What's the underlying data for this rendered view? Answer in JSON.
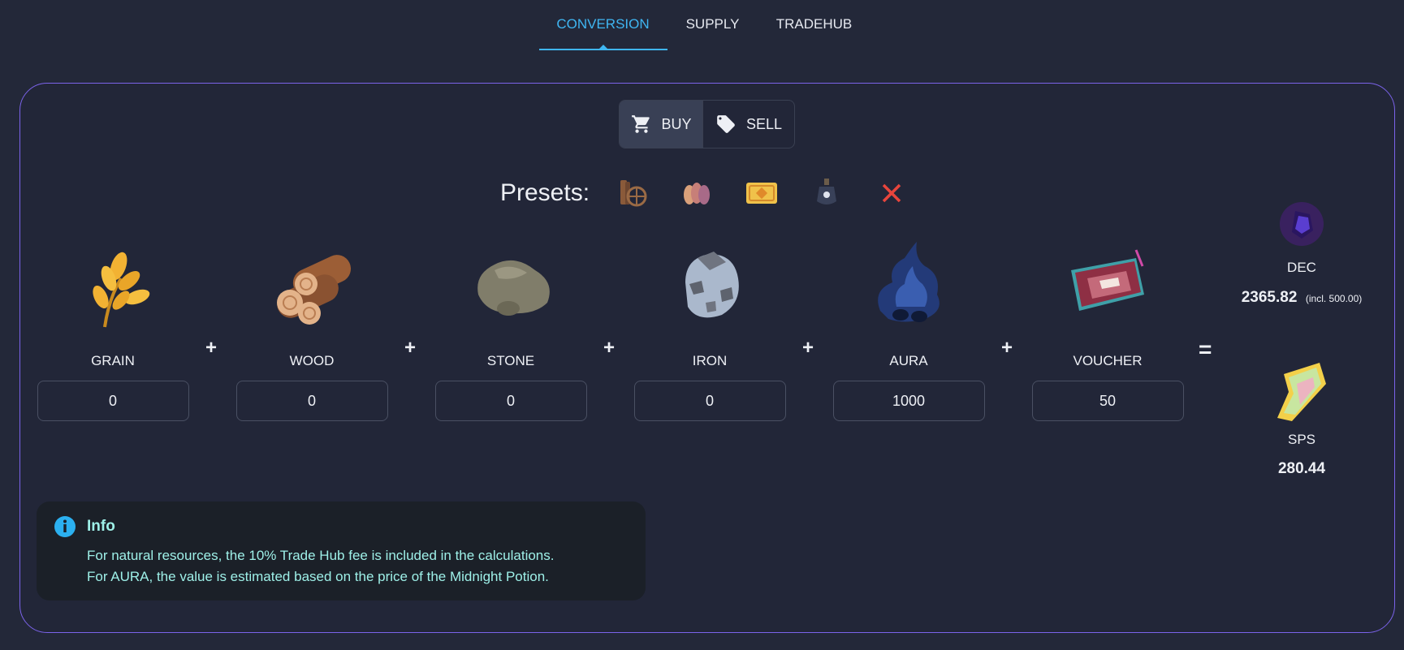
{
  "tabs": [
    {
      "label": "CONVERSION",
      "active": true
    },
    {
      "label": "SUPPLY",
      "active": false
    },
    {
      "label": "TRADEHUB",
      "active": false
    }
  ],
  "toggle": {
    "buy": "BUY",
    "sell": "SELL",
    "selected": "BUY"
  },
  "presets": {
    "label": "Presets:",
    "items": [
      "wood-wheel-preset-icon",
      "grain-seeds-preset-icon",
      "voucher-ticket-preset-icon",
      "potion-lantern-preset-icon",
      "clear-preset-icon"
    ]
  },
  "resources": [
    {
      "label": "GRAIN",
      "value": "0",
      "icon": "grain-icon"
    },
    {
      "label": "WOOD",
      "value": "0",
      "icon": "wood-icon"
    },
    {
      "label": "STONE",
      "value": "0",
      "icon": "stone-icon"
    },
    {
      "label": "IRON",
      "value": "0",
      "icon": "iron-icon"
    },
    {
      "label": "AURA",
      "value": "1000",
      "icon": "aura-icon"
    },
    {
      "label": "VOUCHER",
      "value": "50",
      "icon": "voucher-icon"
    }
  ],
  "operators": {
    "plus": "+",
    "equals": "="
  },
  "results": {
    "dec": {
      "label": "DEC",
      "value": "2365.82",
      "note": "(incl. 500.00)"
    },
    "sps": {
      "label": "SPS",
      "value": "280.44"
    }
  },
  "info": {
    "title": "Info",
    "lines": [
      "For natural resources, the 10% Trade Hub fee is included in the calculations.",
      "For AURA, the value is estimated based on the price of the Midnight Potion."
    ]
  },
  "colors": {
    "accent": "#3fb6f2",
    "panel_border": "#7b63ea",
    "info_text": "#9ef0e8",
    "clear": "#e8453c"
  }
}
